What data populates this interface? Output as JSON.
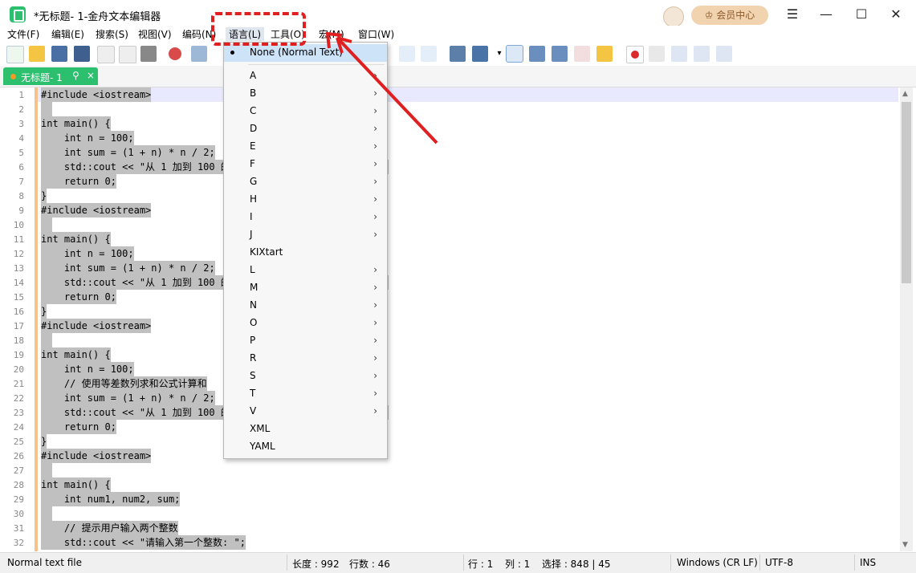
{
  "window": {
    "title": "*无标题- 1-金舟文本编辑器",
    "vip_label": "会员中心",
    "minimize_glyph": "☰",
    "min_glyph": "—",
    "max_glyph": "☐",
    "close_glyph": "✕"
  },
  "menu": {
    "file": "文件(F)",
    "edit": "编辑(E)",
    "search": "搜索(S)",
    "view": "视图(V)",
    "encoding": "编码(N)",
    "language": "语言(L)",
    "tools": "工具(O)",
    "macro": "宏(M)",
    "window": "窗口(W)"
  },
  "tab": {
    "name": "无标题- 1",
    "pin": "⚲",
    "close": "×"
  },
  "editor": {
    "line_numbers": [
      "1",
      "2",
      "3",
      "4",
      "5",
      "6",
      "7",
      "8",
      "9",
      "10",
      "11",
      "12",
      "13",
      "14",
      "15",
      "16",
      "17",
      "18",
      "19",
      "20",
      "21",
      "22",
      "23",
      "24",
      "25",
      "26",
      "27",
      "28",
      "29",
      "30",
      "31",
      "32"
    ],
    "lines": [
      "#include <iostream>",
      "",
      "int main() {",
      "    int n = 100;",
      "    int sum = (1 + n) * n / 2;",
      "    std::cout << \"从 1 加到 100 的和是: \" << sum << std::endl;",
      "    return 0;",
      "}",
      "#include <iostream>",
      "",
      "int main() {",
      "    int n = 100;",
      "    int sum = (1 + n) * n / 2;",
      "    std::cout << \"从 1 加到 100 的和是: \" << sum << std::endl;",
      "    return 0;",
      "}",
      "#include <iostream>",
      "",
      "int main() {",
      "    int n = 100;",
      "    // 使用等差数列求和公式计算和",
      "    int sum = (1 + n) * n / 2;",
      "    std::cout << \"从 1 加到 100 的和是: \" << sum << std::endl;",
      "    return 0;",
      "}",
      "#include <iostream>",
      "",
      "int main() {",
      "    int num1, num2, sum;",
      "",
      "    // 提示用户输入两个整数",
      "    std::cout << \"请输入第一个整数: \";"
    ]
  },
  "language_menu": {
    "items": [
      {
        "label": "None (Normal Text)",
        "checked": true,
        "submenu": false
      },
      {
        "label": "A",
        "checked": false,
        "submenu": true
      },
      {
        "label": "B",
        "checked": false,
        "submenu": true
      },
      {
        "label": "C",
        "checked": false,
        "submenu": true
      },
      {
        "label": "D",
        "checked": false,
        "submenu": true
      },
      {
        "label": "E",
        "checked": false,
        "submenu": true
      },
      {
        "label": "F",
        "checked": false,
        "submenu": true
      },
      {
        "label": "G",
        "checked": false,
        "submenu": true
      },
      {
        "label": "H",
        "checked": false,
        "submenu": true
      },
      {
        "label": "I",
        "checked": false,
        "submenu": true
      },
      {
        "label": "J",
        "checked": false,
        "submenu": true
      },
      {
        "label": "KIXtart",
        "checked": false,
        "submenu": false
      },
      {
        "label": "L",
        "checked": false,
        "submenu": true
      },
      {
        "label": "M",
        "checked": false,
        "submenu": true
      },
      {
        "label": "N",
        "checked": false,
        "submenu": true
      },
      {
        "label": "O",
        "checked": false,
        "submenu": true
      },
      {
        "label": "P",
        "checked": false,
        "submenu": true
      },
      {
        "label": "R",
        "checked": false,
        "submenu": true
      },
      {
        "label": "S",
        "checked": false,
        "submenu": true
      },
      {
        "label": "T",
        "checked": false,
        "submenu": true
      },
      {
        "label": "V",
        "checked": false,
        "submenu": true
      },
      {
        "label": "XML",
        "checked": false,
        "submenu": false
      },
      {
        "label": "YAML",
        "checked": false,
        "submenu": false
      }
    ],
    "arrow_glyph": "›"
  },
  "status": {
    "filetype": "Normal text file",
    "length": "长度 : 992",
    "lines": "行数 : 46",
    "row": "行 : 1",
    "col": "列 : 1",
    "selection": "选择 : 848 | 45",
    "eol": "Windows (CR LF)",
    "encoding": "UTF-8",
    "mode": "INS"
  },
  "colors": {
    "accent_green": "#2cbf6e",
    "annotation_red": "#e02020",
    "selection_gray": "#c0c0c0",
    "fold_orange": "#f6c28b"
  },
  "icons": [
    "new-file-icon",
    "open-folder-icon",
    "save-icon",
    "save-all-icon",
    "close-icon",
    "close-all-icon",
    "print-icon",
    "cut-icon",
    "copy-icon",
    "wrap-icon",
    "show-all-chars-icon",
    "indent-guide-icon",
    "doc-map-icon",
    "function-list-icon",
    "folder-workspace-icon",
    "record-macro-icon",
    "stop-macro-icon",
    "play-macro-icon",
    "run-macro-multiple-icon",
    "save-macro-icon"
  ]
}
